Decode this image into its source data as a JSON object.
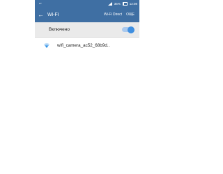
{
  "status_bar": {
    "left_icon": "usb-icon",
    "signal_icon": "signal-icon",
    "battery_percent": "35%",
    "time": "12:08"
  },
  "app_bar": {
    "back_icon": "back-arrow-icon",
    "title": "Wi-Fi",
    "actions": [
      "Wi-Fi Direct",
      "ОЩЕ"
    ]
  },
  "wifi_toggle": {
    "label": "Включено",
    "state": "on"
  },
  "networks": [
    {
      "name": "wifi_camera_ac52_68b9d..",
      "icon": "wifi-icon"
    }
  ],
  "colors": {
    "header": "#3f6fa3",
    "toggle_row_bg": "#eaeaea",
    "switch_knob": "#3f8fe0",
    "switch_track": "#a9c9ee",
    "wifi_icon": "#1e88e5"
  }
}
